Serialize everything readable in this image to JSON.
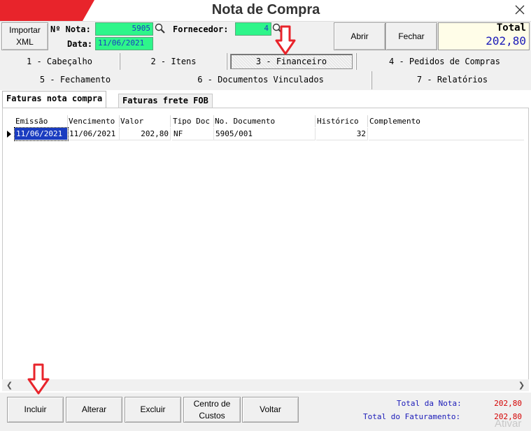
{
  "window": {
    "title": "Nota de Compra",
    "close_icon": "close-icon"
  },
  "header": {
    "import_button": "Importar XML",
    "nota_label": "Nº Nota:",
    "nota_value": "5905",
    "data_label": "Data:",
    "data_value": "11/06/2021",
    "fornecedor_label": "Fornecedor:",
    "fornecedor_value": "4",
    "search_icon": "magnifier-icon",
    "abrir_button": "Abrir",
    "fechar_button": "Fechar",
    "total_label": "Total",
    "total_value": "202,80"
  },
  "main_tabs": [
    {
      "label": "1 - Cabeçalho"
    },
    {
      "label": "2 - Itens"
    },
    {
      "label": "3 - Financeiro",
      "selected": true
    },
    {
      "label": "4 - Pedidos de Compras"
    },
    {
      "label": "5 - Fechamento"
    },
    {
      "label": "6 - Documentos Vinculados"
    },
    {
      "label": "7 - Relatórios"
    }
  ],
  "sub_tabs": [
    {
      "label": "Faturas nota compra",
      "active": true
    },
    {
      "label": "Faturas frete FOB",
      "active": false
    }
  ],
  "grid": {
    "columns": [
      "Emissão",
      "Vencimento",
      "Valor",
      "Tipo Doc",
      "No. Documento",
      "Histórico",
      "Complemento"
    ],
    "rows": [
      {
        "emissao": "11/06/2021",
        "vencimento": "11/06/2021",
        "valor": "202,80",
        "tipo_doc": "NF",
        "no_documento": "5905/001",
        "historico": "32",
        "complemento": ""
      }
    ]
  },
  "actions": {
    "incluir": "Incluir",
    "alterar": "Alterar",
    "excluir": "Excluir",
    "centro_custos": "Centro de Custos",
    "voltar": "Voltar"
  },
  "summary": {
    "total_nota_label": "Total da Nota:",
    "total_nota_value": "202,80",
    "total_faturamento_label": "Total do Faturamento:",
    "total_faturamento_value": "202,80"
  },
  "watermark": "Ativar",
  "colors": {
    "accent_red": "#e8242b",
    "field_green": "#2ef58a",
    "value_blue": "#1a1ab8",
    "summary_red": "#d40000"
  }
}
